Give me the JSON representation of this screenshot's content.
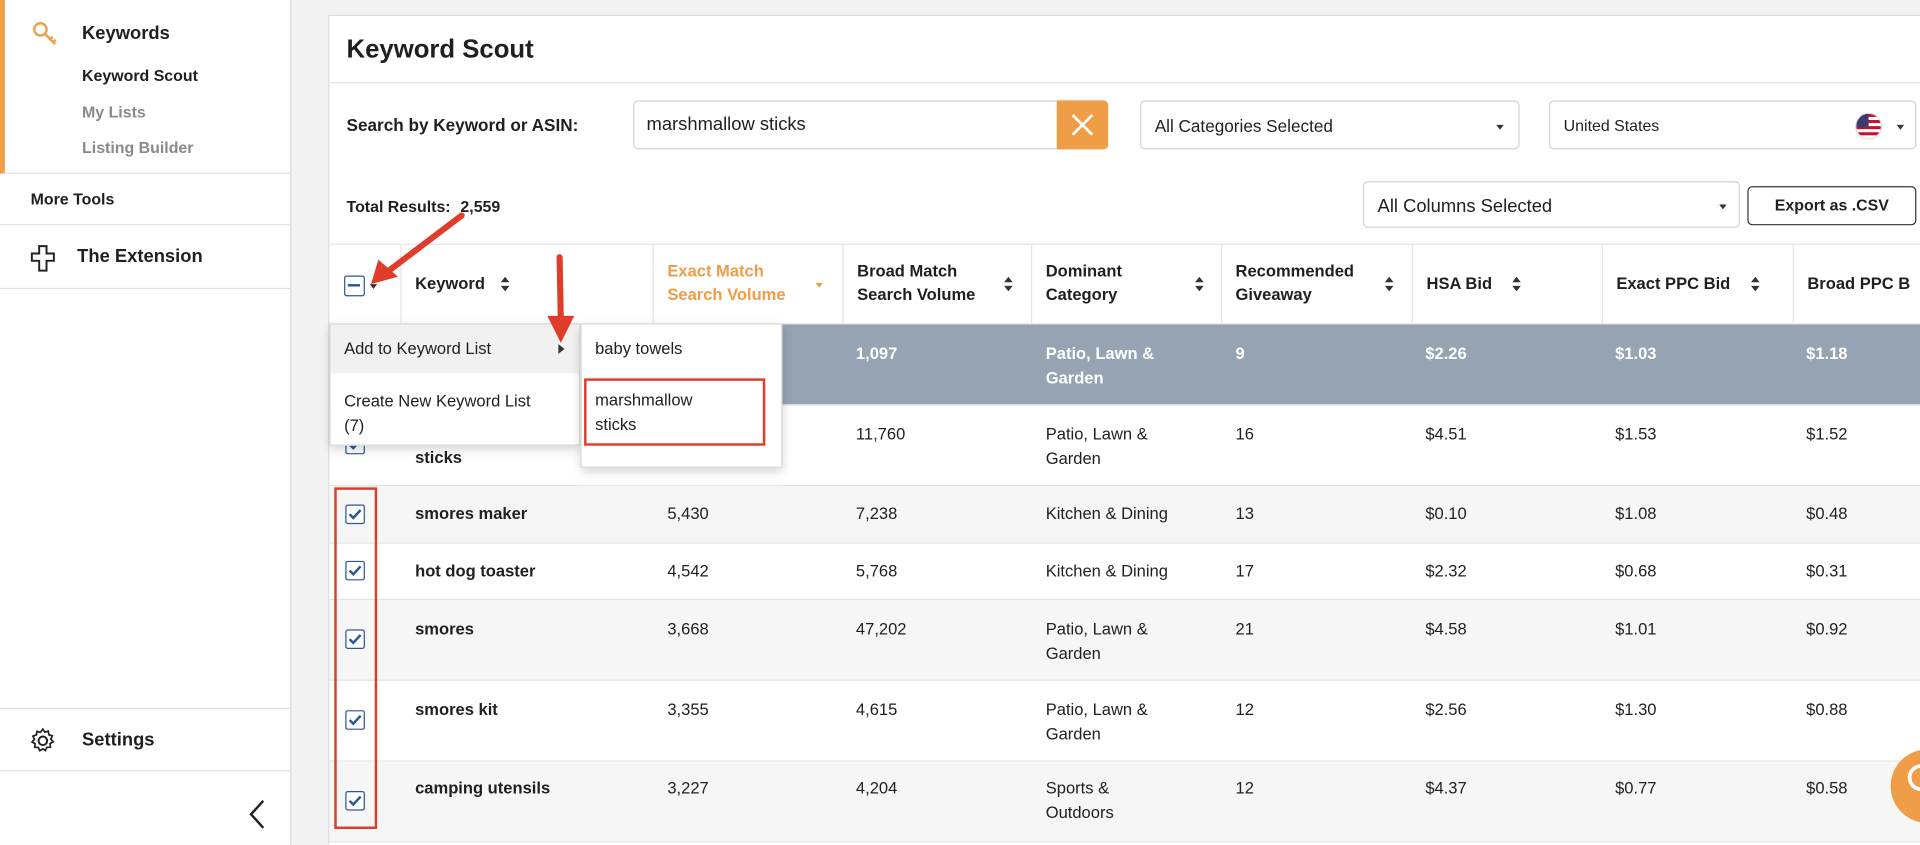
{
  "sidebar": {
    "keywords_title": "Keywords",
    "sub_items": [
      "Keyword Scout",
      "My Lists",
      "Listing Builder"
    ],
    "more_tools": "More Tools",
    "extension": "The Extension",
    "settings": "Settings",
    "accent_color": "#f0a04b"
  },
  "page": {
    "title": "Keyword Scout",
    "search_label": "Search by Keyword or ASIN:",
    "search_value": "marshmallow sticks",
    "category_select": "All Categories Selected",
    "country_select": "United States",
    "total_label": "Total Results:",
    "total_value": "2,559",
    "columns_select": "All Columns Selected",
    "export_label": "Export as .CSV"
  },
  "table": {
    "headers": {
      "keyword": "Keyword",
      "exact1": "Exact Match",
      "exact2": "Search Volume",
      "broad1": "Broad Match",
      "broad2": "Search Volume",
      "cat1": "Dominant",
      "cat2": "Category",
      "give1": "Recommended",
      "give2": "Giveaway",
      "hsa": "HSA Bid",
      "exactppc": "Exact PPC Bid",
      "broadppc": "Broad PPC B"
    },
    "rows": [
      {
        "keyword": "",
        "exact": "",
        "broad": "1,097",
        "cat1": "Patio, Lawn &",
        "cat2": "Garden",
        "give": "9",
        "hsa": "$2.26",
        "eppc": "$1.03",
        "bppc": "$1.18"
      },
      {
        "keyword": "sticks",
        "exact": "",
        "broad": "11,760",
        "cat1": "Patio, Lawn &",
        "cat2": "Garden",
        "give": "16",
        "hsa": "$4.51",
        "eppc": "$1.53",
        "bppc": "$1.52"
      },
      {
        "keyword": "smores maker",
        "exact": "5,430",
        "broad": "7,238",
        "cat1": "Kitchen & Dining",
        "cat2": "",
        "give": "13",
        "hsa": "$0.10",
        "eppc": "$1.08",
        "bppc": "$0.48"
      },
      {
        "keyword": "hot dog toaster",
        "exact": "4,542",
        "broad": "5,768",
        "cat1": "Kitchen & Dining",
        "cat2": "",
        "give": "17",
        "hsa": "$2.32",
        "eppc": "$0.68",
        "bppc": "$0.31"
      },
      {
        "keyword": "smores",
        "exact": "3,668",
        "broad": "47,202",
        "cat1": "Patio, Lawn &",
        "cat2": "Garden",
        "give": "21",
        "hsa": "$4.58",
        "eppc": "$1.01",
        "bppc": "$0.92"
      },
      {
        "keyword": "smores kit",
        "exact": "3,355",
        "broad": "4,615",
        "cat1": "Patio, Lawn &",
        "cat2": "Garden",
        "give": "12",
        "hsa": "$2.56",
        "eppc": "$1.30",
        "bppc": "$0.88"
      },
      {
        "keyword": "camping utensils",
        "exact": "3,227",
        "broad": "4,204",
        "cat1": "Sports &",
        "cat2": "Outdoors",
        "give": "12",
        "hsa": "$4.37",
        "eppc": "$0.77",
        "bppc": "$0.58"
      }
    ]
  },
  "menu": {
    "add_to_list": "Add to Keyword List",
    "create_new_1": "Create New Keyword List",
    "create_new_2": "(7)",
    "lists": [
      "baby towels",
      "marshmallow",
      "sticks"
    ]
  },
  "colors": {
    "accent": "#ef9d46",
    "highlight_row": "#95a3b2",
    "annotation_red": "#dd3d2a",
    "checkbox_blue": "#2b5797"
  }
}
